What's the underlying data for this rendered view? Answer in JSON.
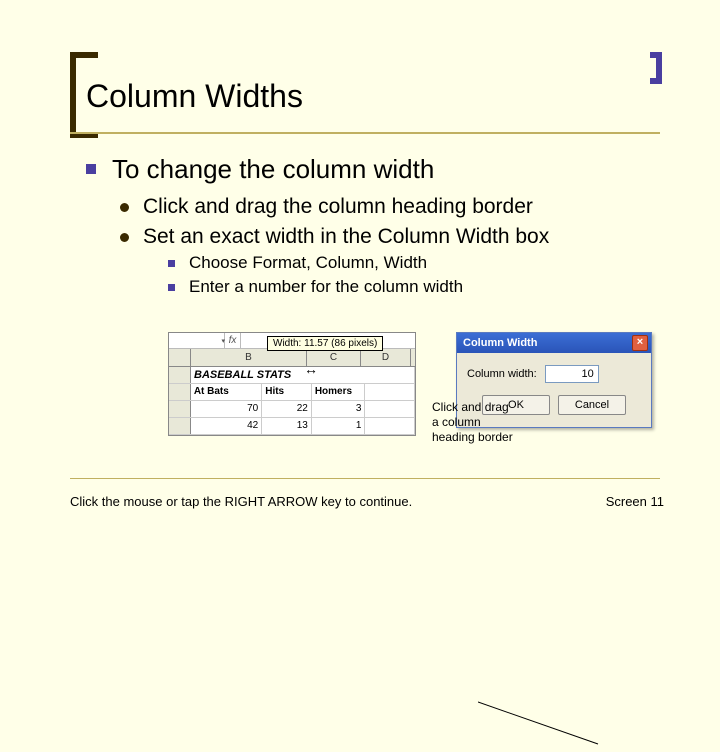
{
  "title": "Column Widths",
  "bullets": {
    "l1": "To change the column width",
    "l2a": "Click and drag the column heading border",
    "l2b": "Set an exact width in the Column Width box",
    "l3a": "Choose Format, Column, Width",
    "l3b": "Enter a number for the column width"
  },
  "excel": {
    "fx": "fx",
    "tooltip": "Width: 11.57 (86 pixels)",
    "cols": {
      "B": "B",
      "C": "C",
      "D": "D"
    },
    "r1_title": "BASEBALL STATS",
    "r2": {
      "a": "At Bats",
      "b": "Hits",
      "c": "Homers"
    },
    "r3": {
      "a": "70",
      "b": "22",
      "c": "3"
    },
    "r4": {
      "a": "42",
      "b": "13",
      "c": "1"
    }
  },
  "dialog": {
    "title": "Column Width",
    "label": "Column width:",
    "value": "10",
    "ok": "OK",
    "cancel": "Cancel"
  },
  "callout": {
    "l1": "Click and drag",
    "l2": "a column",
    "l3": "heading border"
  },
  "footer": {
    "left": "Click the mouse or tap the RIGHT ARROW key to continue.",
    "right": "Screen 11"
  }
}
